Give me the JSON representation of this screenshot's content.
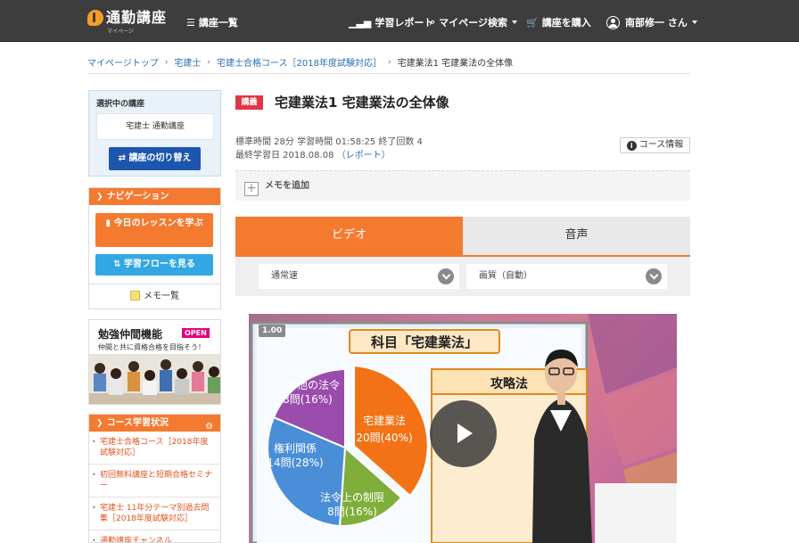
{
  "header": {
    "logo_text": "通勤講座",
    "logo_sub": "マイページ",
    "course_list": "講座一覧",
    "report": "学習レポート",
    "search": "マイページ検索",
    "purchase": "講座を購入",
    "user": "南部修一 さん"
  },
  "breadcrumb": [
    "マイページトップ",
    "宅建士",
    "宅建士合格コース［2018年度試験対応］",
    "宅建業法1 宅建業法の全体像"
  ],
  "sidebar": {
    "selected_heading": "選択中の講座",
    "selected_course": "宅建士 通勤講座",
    "switch_label": "講座の切り替え",
    "nav_heading": "ナビゲーション",
    "lesson_today": "今日のレッスンを学ぶ",
    "flow": "学習フローを見る",
    "memo_list": "メモ一覧",
    "banner_title": "勉強仲間機能",
    "banner_open": "OPEN",
    "banner_sub": "仲間と共に資格合格を目指そう！",
    "status_heading": "コース学習状況",
    "status_items": [
      "宅建士合格コース［2018年度試験対応］",
      "初回無料講座と短期合格セミナー",
      "宅建士 11年分テーマ別過去問集［2018年度試験対応］",
      "通勤講座チャンネル"
    ]
  },
  "lesson": {
    "badge": "講義",
    "title": "宅建業法1 宅建業法の全体像",
    "meta1": "標準時間  28分    学習時間  01:58:25    終了回数  4",
    "meta2_prefix": "最終学習日  2018.08.08  ",
    "meta2_link": "（レポート）",
    "course_info": "コース情報",
    "memo_add": "メモを追加"
  },
  "tabs": {
    "video": "ビデオ",
    "audio": "音声"
  },
  "selects": {
    "speed": "通常速",
    "quality": "画質（自動）"
  },
  "player": {
    "speed_badge": "1.00",
    "board_title": "科目「宅建業法」",
    "panel_title": "攻略法",
    "pie_labels": {
      "gyoho": [
        "宅建業法",
        "20問(40%)"
      ],
      "kenri": [
        "権利関係",
        "14問(28%)"
      ],
      "horei": [
        "法令上の制限",
        "8問(16%)"
      ],
      "sonota": [
        "その他の法令",
        "8問(16%)"
      ]
    }
  },
  "colors": {
    "accent": "#f47a30",
    "header_bg": "#3d3d3d",
    "primary_blue": "#1d57ad",
    "light_blue": "#33a7e3",
    "badge_red": "#e03546"
  }
}
